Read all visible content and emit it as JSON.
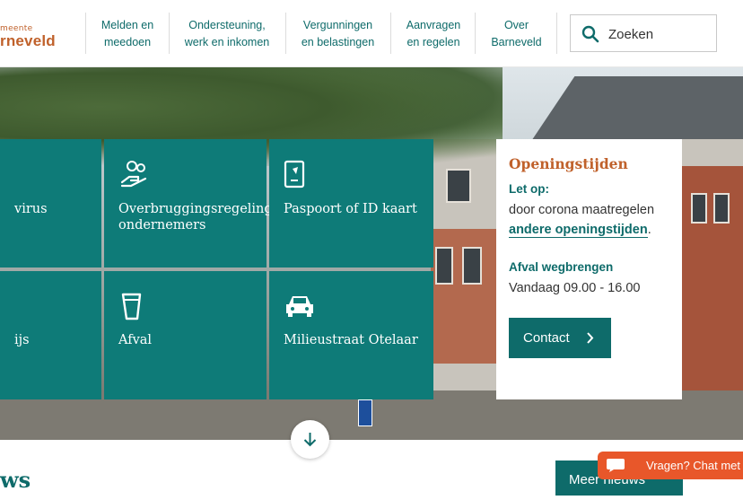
{
  "logo": {
    "line1": "meente",
    "line2": "rneveld"
  },
  "nav": [
    {
      "line1": "Melden en",
      "line2": "meedoen"
    },
    {
      "line1": "Ondersteuning,",
      "line2": "werk en inkomen"
    },
    {
      "line1": "Vergunningen",
      "line2": "en belastingen"
    },
    {
      "line1": "Aanvragen",
      "line2": "en regelen"
    },
    {
      "line1": "Over",
      "line2": "Barneveld"
    }
  ],
  "search": {
    "placeholder": "Zoeken"
  },
  "tiles": [
    {
      "label": "virus",
      "icon": "virus-icon"
    },
    {
      "label": "Overbruggingsregeling ondernemers",
      "icon": "handshake-coins-icon"
    },
    {
      "label": "Paspoort of ID kaart",
      "icon": "passport-icon"
    },
    {
      "label": "ijs",
      "icon": "truncated-icon"
    },
    {
      "label": "Afval",
      "icon": "trash-bin-icon"
    },
    {
      "label": "Milieustraat Otelaar",
      "icon": "car-icon"
    }
  ],
  "hours": {
    "title": "Openingstijden",
    "notice_label": "Let op:",
    "notice_text": "door corona maatregelen",
    "link": "andere openingstijden",
    "link_suffix": ".",
    "waste_label": "Afval wegbrengen",
    "waste_time": "Vandaag 09.00 - 16.00",
    "contact_button": "Contact"
  },
  "news": {
    "title": "ws",
    "more_button": "Meer nieuws"
  },
  "chat": {
    "label": "Vragen? Chat met o"
  },
  "colors": {
    "primary": "#0e6b6a",
    "tile": "#0e7b78",
    "accent": "#c0612b",
    "chat": "#e8572a"
  }
}
